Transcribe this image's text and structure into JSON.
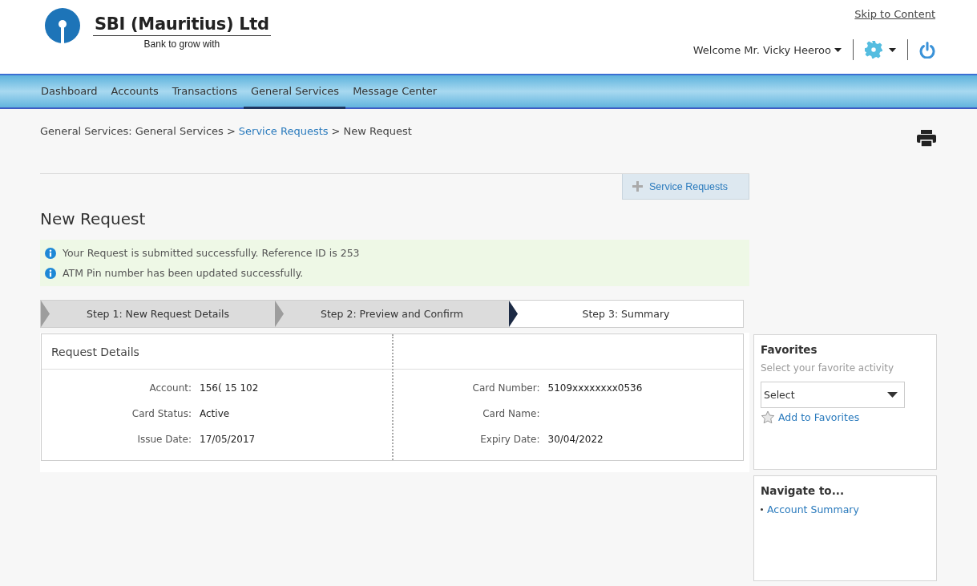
{
  "brand": {
    "name": "SBI (Mauritius) Ltd",
    "tagline": "Bank to grow with"
  },
  "skip_link": "Skip to Content",
  "user_menu": {
    "welcome": "Welcome",
    "name": "Mr. Vicky Heeroo"
  },
  "nav": [
    {
      "label": "Dashboard",
      "selected": false
    },
    {
      "label": "Accounts",
      "selected": false
    },
    {
      "label": "Transactions",
      "selected": false
    },
    {
      "label": "General Services",
      "selected": true
    },
    {
      "label": "Message Center",
      "selected": false
    }
  ],
  "breadcrumb": {
    "separator": ">",
    "items": [
      {
        "label": "General Services: General Services",
        "kind": "text"
      },
      {
        "label": "Service Requests",
        "kind": "link"
      },
      {
        "label": "New Request",
        "kind": "text"
      }
    ]
  },
  "service_requests_button": "Service Requests",
  "heading": "New Request",
  "messages": [
    "Your Request is submitted successfully. Reference ID is 253",
    "ATM Pin number has been updated successfully."
  ],
  "steps": [
    {
      "label": "Step 1: New Request Details",
      "selected": false
    },
    {
      "label": "Step 2: Preview and Confirm",
      "selected": false
    },
    {
      "label": "Step 3: Summary",
      "selected": true
    }
  ],
  "details": {
    "title": "Request Details",
    "left": [
      {
        "label": "Account:",
        "value": "156( 15 102"
      },
      {
        "label": "Card Status:",
        "value": "Active"
      },
      {
        "label": "Issue Date:",
        "value": "17/05/2017"
      }
    ],
    "right": [
      {
        "label": "Card Number:",
        "value": "5109xxxxxxxx0536"
      },
      {
        "label": "Card Name:"
      },
      {
        "label": "Expiry Date:",
        "value": "30/04/2022"
      }
    ]
  },
  "favorites": {
    "title": "Favorites",
    "hint": "Select your favorite activity",
    "select": "Select",
    "add_link": "Add to Favorites"
  },
  "navigate": {
    "title": "Navigate to...",
    "links": [
      "Account Summary"
    ]
  }
}
